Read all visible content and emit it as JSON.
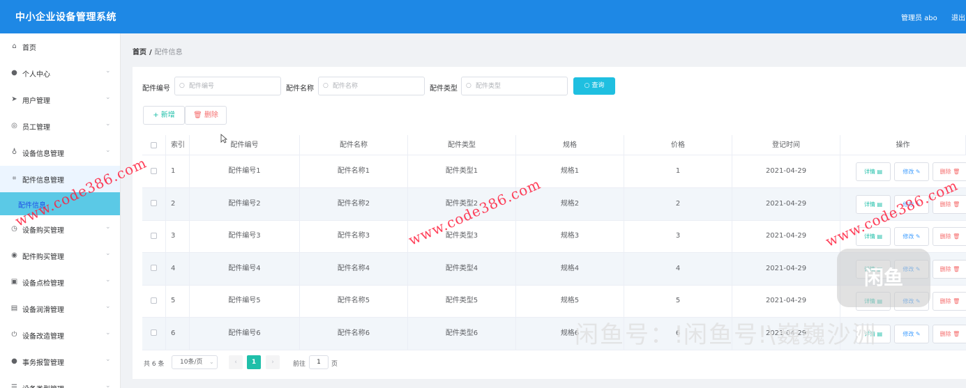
{
  "app": {
    "title": "中小企业设备管理系统",
    "user": "管理员 abo",
    "logout": "退出"
  },
  "sidebar": {
    "items": [
      {
        "label": "首页",
        "icon": "home-icon",
        "glyph": "⌂",
        "arrow": ""
      },
      {
        "label": "个人中心",
        "icon": "person-icon",
        "glyph": "●",
        "arrow": "⌄"
      },
      {
        "label": "用户管理",
        "icon": "send-icon",
        "glyph": "➤",
        "arrow": "⌄"
      },
      {
        "label": "员工管理",
        "icon": "compass-icon",
        "glyph": "◎",
        "arrow": "⌄"
      },
      {
        "label": "设备信息管理",
        "icon": "pin-icon",
        "glyph": "♁",
        "arrow": "⌄"
      },
      {
        "label": "配件信息管理",
        "icon": "crop-icon",
        "glyph": "⌗",
        "arrow": "⌃"
      },
      {
        "label": "设备购买管理",
        "icon": "clock-icon",
        "glyph": "◷",
        "arrow": "⌄"
      },
      {
        "label": "配件购买管理",
        "icon": "target-icon",
        "glyph": "◉",
        "arrow": "⌄"
      },
      {
        "label": "设备点检管理",
        "icon": "clipboard-icon",
        "glyph": "▣",
        "arrow": "⌄"
      },
      {
        "label": "设备润滑管理",
        "icon": "chart-icon",
        "glyph": "▤",
        "arrow": "⌄"
      },
      {
        "label": "设备改造管理",
        "icon": "power-icon",
        "glyph": "⏻",
        "arrow": "⌄"
      },
      {
        "label": "事务报警管理",
        "icon": "user-icon",
        "glyph": "●",
        "arrow": "⌄"
      },
      {
        "label": "设备类型管理",
        "icon": "list-icon",
        "glyph": "☰",
        "arrow": "⌄"
      }
    ],
    "active_sub": "配件信息"
  },
  "breadcrumb": {
    "home": "首页",
    "sep": "/",
    "current": "配件信息"
  },
  "search": {
    "field1_label": "配件编号",
    "field1_placeholder": "配件编号",
    "field2_label": "配件名称",
    "field2_placeholder": "配件名称",
    "field3_label": "配件类型",
    "field3_placeholder": "配件类型",
    "query_label": "○ 查询"
  },
  "toolbar": {
    "add_label": "+ 新增",
    "delete_label": "🗑 删除"
  },
  "table": {
    "headers": [
      "索引",
      "配件编号",
      "配件名称",
      "配件类型",
      "规格",
      "价格",
      "登记时间",
      "操作"
    ],
    "rows": [
      {
        "index": "1",
        "code": "配件编号1",
        "name": "配件名称1",
        "type": "配件类型1",
        "spec": "规格1",
        "price": "1",
        "date": "2021-04-29"
      },
      {
        "index": "2",
        "code": "配件编号2",
        "name": "配件名称2",
        "type": "配件类型2",
        "spec": "规格2",
        "price": "2",
        "date": "2021-04-29"
      },
      {
        "index": "3",
        "code": "配件编号3",
        "name": "配件名称3",
        "type": "配件类型3",
        "spec": "规格3",
        "price": "3",
        "date": "2021-04-29"
      },
      {
        "index": "4",
        "code": "配件编号4",
        "name": "配件名称4",
        "type": "配件类型4",
        "spec": "规格4",
        "price": "4",
        "date": "2021-04-29"
      },
      {
        "index": "5",
        "code": "配件编号5",
        "name": "配件名称5",
        "type": "配件类型5",
        "spec": "规格5",
        "price": "5",
        "date": "2021-04-29"
      },
      {
        "index": "6",
        "code": "配件编号6",
        "name": "配件名称6",
        "type": "配件类型6",
        "spec": "规格6",
        "price": "6",
        "date": "2021-04-29"
      }
    ],
    "actions": {
      "detail": "详情 ▤",
      "edit": "修改 ✎",
      "remove": "删除 🗑"
    }
  },
  "pagination": {
    "total": "共 6 条",
    "page_size": "10条/页",
    "prev": "‹",
    "current": "1",
    "next": "›",
    "goto_prefix": "前往",
    "goto_value": "1",
    "goto_suffix": "页"
  },
  "watermarks": {
    "url": "www.code386.com",
    "app_logo": "闲鱼",
    "app_text": "闲鱼号：ǃ闲鱼号ǃ\\巍巍沙洲"
  },
  "colors": {
    "header": "#1e88e5",
    "accent": "#1fbfa9",
    "query": "#1fbfe0",
    "danger": "#f56c6c",
    "active_menu": "#5bc9e6"
  }
}
